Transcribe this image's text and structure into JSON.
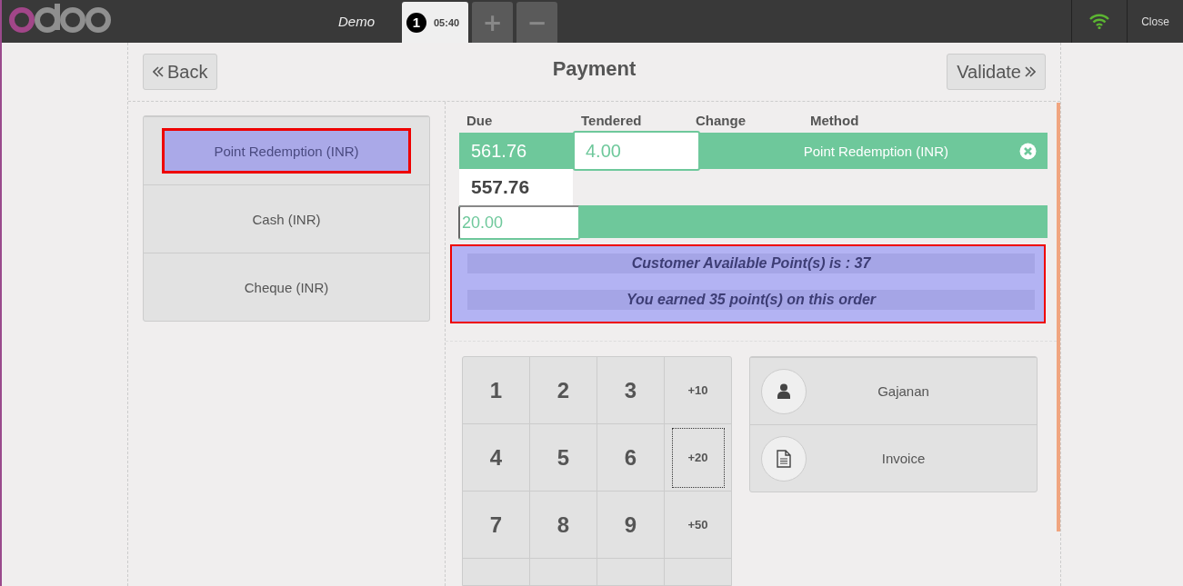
{
  "topbar": {
    "user": "Demo",
    "orders": [
      {
        "number": "1",
        "time": "05:40",
        "selected": true
      }
    ],
    "new_order": "+",
    "delete_order": "−",
    "close": "Close"
  },
  "header": {
    "back": "Back",
    "title": "Payment",
    "validate": "Validate"
  },
  "methods": [
    {
      "label": "Point Redemption (INR)",
      "highlighted": true
    },
    {
      "label": "Cash (INR)",
      "highlighted": false
    },
    {
      "label": "Cheque (INR)",
      "highlighted": false
    }
  ],
  "paymentlines": {
    "columns": [
      "Due",
      "Tendered",
      "Change",
      "Method"
    ],
    "lines": [
      {
        "due": "561.76",
        "tendered": "4.00",
        "method": "Point Redemption (INR)"
      }
    ],
    "remaining": "557.76",
    "extra_input": "20.00"
  },
  "points_info": {
    "highlighted": true,
    "messages": [
      "Customer Available Point(s) is : 37",
      "You earned 35 point(s) on this order"
    ]
  },
  "numpad": [
    {
      "label": "1",
      "kind": "digit",
      "focused": false
    },
    {
      "label": "2",
      "kind": "digit",
      "focused": false
    },
    {
      "label": "3",
      "kind": "digit",
      "focused": false
    },
    {
      "label": "+10",
      "kind": "amount",
      "focused": false
    },
    {
      "label": "4",
      "kind": "digit",
      "focused": false
    },
    {
      "label": "5",
      "kind": "digit",
      "focused": false
    },
    {
      "label": "6",
      "kind": "digit",
      "focused": false
    },
    {
      "label": "+20",
      "kind": "amount",
      "focused": true
    },
    {
      "label": "7",
      "kind": "digit",
      "focused": false
    },
    {
      "label": "8",
      "kind": "digit",
      "focused": false
    },
    {
      "label": "9",
      "kind": "digit",
      "focused": false
    },
    {
      "label": "+50",
      "kind": "amount",
      "focused": false
    }
  ],
  "actions": [
    {
      "label": "Gajanan",
      "kind": "customer"
    },
    {
      "label": "Invoice",
      "kind": "invoice"
    }
  ]
}
